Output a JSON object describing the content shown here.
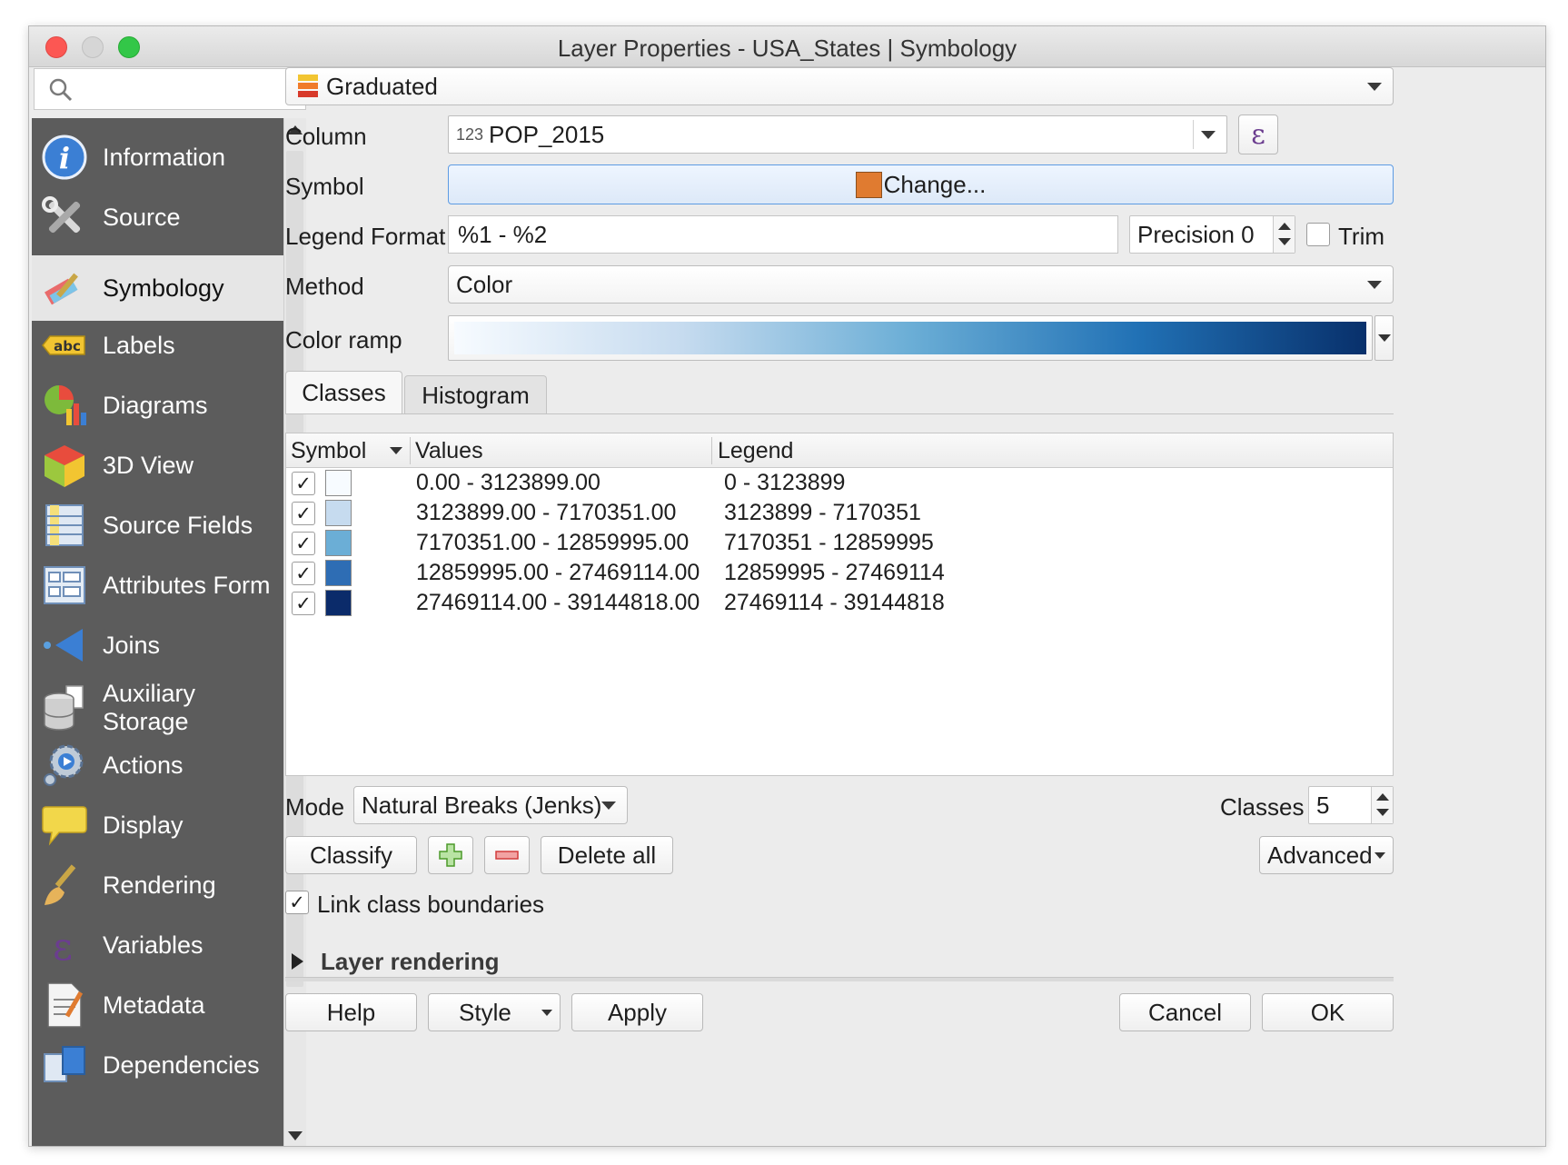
{
  "window": {
    "title": "Layer Properties - USA_States | Symbology"
  },
  "sidebar": {
    "search_placeholder": "",
    "items": [
      {
        "label": "Information",
        "icon": "info-icon"
      },
      {
        "label": "Source",
        "icon": "tools-icon"
      },
      {
        "label": "Symbology",
        "icon": "paintbrush-icon",
        "active": true
      },
      {
        "label": "Labels",
        "icon": "abc-label-icon"
      },
      {
        "label": "Diagrams",
        "icon": "pie-chart-icon"
      },
      {
        "label": "3D View",
        "icon": "cube-icon"
      },
      {
        "label": "Source Fields",
        "icon": "table-fields-icon"
      },
      {
        "label": "Attributes Form",
        "icon": "form-icon"
      },
      {
        "label": "Joins",
        "icon": "join-icon"
      },
      {
        "label": "Auxiliary\nStorage",
        "icon": "database-icon"
      },
      {
        "label": "Actions",
        "icon": "gear-icon"
      },
      {
        "label": "Display",
        "icon": "speech-bubble-icon"
      },
      {
        "label": "Rendering",
        "icon": "brush-icon"
      },
      {
        "label": "Variables",
        "icon": "epsilon-icon"
      },
      {
        "label": "Metadata",
        "icon": "document-icon"
      },
      {
        "label": "Dependencies",
        "icon": "dependencies-icon"
      }
    ]
  },
  "renderer": {
    "type": "Graduated"
  },
  "form": {
    "column_label": "Column",
    "column_type_badge": "123",
    "column_value": "POP_2015",
    "expression_glyph": "ε",
    "symbol_label": "Symbol",
    "symbol_button": "Change...",
    "symbol_color": "#e07b30",
    "legend_format_label": "Legend Format",
    "legend_format_value": "%1 - %2",
    "precision_value": "Precision 0",
    "trim_label": "Trim",
    "method_label": "Method",
    "method_value": "Color",
    "color_ramp_label": "Color ramp",
    "color_ramp_stops": [
      "#f7fbff",
      "#c6dbef",
      "#6baed6",
      "#2171b5",
      "#08306b"
    ]
  },
  "tabs": [
    {
      "label": "Classes",
      "active": true
    },
    {
      "label": "Histogram",
      "active": false
    }
  ],
  "table": {
    "headers": [
      "Symbol",
      "Values",
      "Legend"
    ],
    "rows": [
      {
        "checked": "✓",
        "color": "#f7fbff",
        "values": "0.00 - 3123899.00",
        "legend": "0 - 3123899"
      },
      {
        "checked": "✓",
        "color": "#c6dbef",
        "values": "3123899.00 - 7170351.00",
        "legend": "3123899 - 7170351"
      },
      {
        "checked": "✓",
        "color": "#6baed6",
        "values": "7170351.00 - 12859995.00",
        "legend": "7170351 - 12859995"
      },
      {
        "checked": "✓",
        "color": "#2e6db4",
        "values": "12859995.00 - 27469114.00",
        "legend": "12859995 - 27469114"
      },
      {
        "checked": "✓",
        "color": "#0b2b6a",
        "values": "27469114.00 - 39144818.00",
        "legend": "27469114 - 39144818"
      }
    ]
  },
  "mode": {
    "label": "Mode",
    "value": "Natural Breaks (Jenks)",
    "classes_label": "Classes",
    "classes_value": "5"
  },
  "actions": {
    "classify": "Classify",
    "delete_all": "Delete all",
    "advanced": "Advanced",
    "link_check": "✓",
    "link_class_boundaries": "Link class boundaries",
    "layer_rendering": "Layer rendering"
  },
  "footer": {
    "help": "Help",
    "style": "Style",
    "apply": "Apply",
    "cancel": "Cancel",
    "ok": "OK"
  }
}
